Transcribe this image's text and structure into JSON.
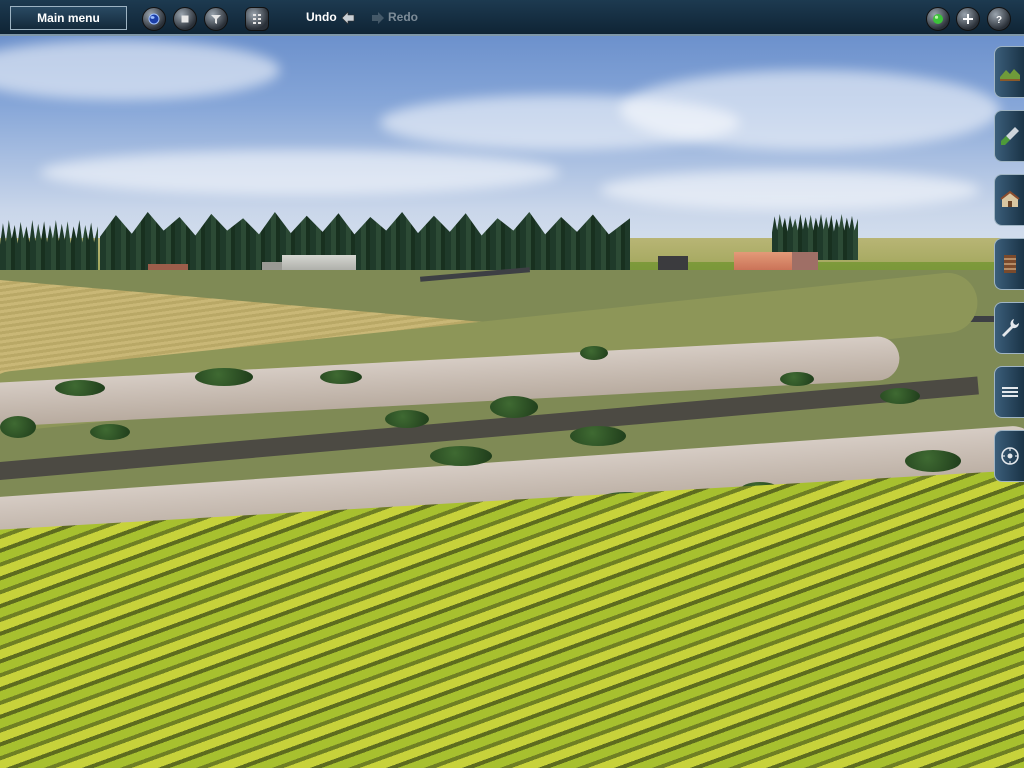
{
  "toolbar": {
    "main_menu_label": "Main menu",
    "undo_label": "Undo",
    "redo_label": "Redo",
    "left_buttons": [
      "globe-icon",
      "stop-icon",
      "filter-icon",
      "grid-icon"
    ],
    "right_buttons": [
      "status-light-icon",
      "plus-icon",
      "help-icon"
    ],
    "redo_enabled": false
  },
  "side_palette": {
    "tools": [
      "topology-tool",
      "paint-tool",
      "objects-tool",
      "track-tool",
      "tools-tool",
      "layers-tool",
      "compass-tool"
    ]
  },
  "colors": {
    "toolbar_bg": "#16303f",
    "toolbar_border": "#7f97a8",
    "status_light": "#3cc23a"
  }
}
